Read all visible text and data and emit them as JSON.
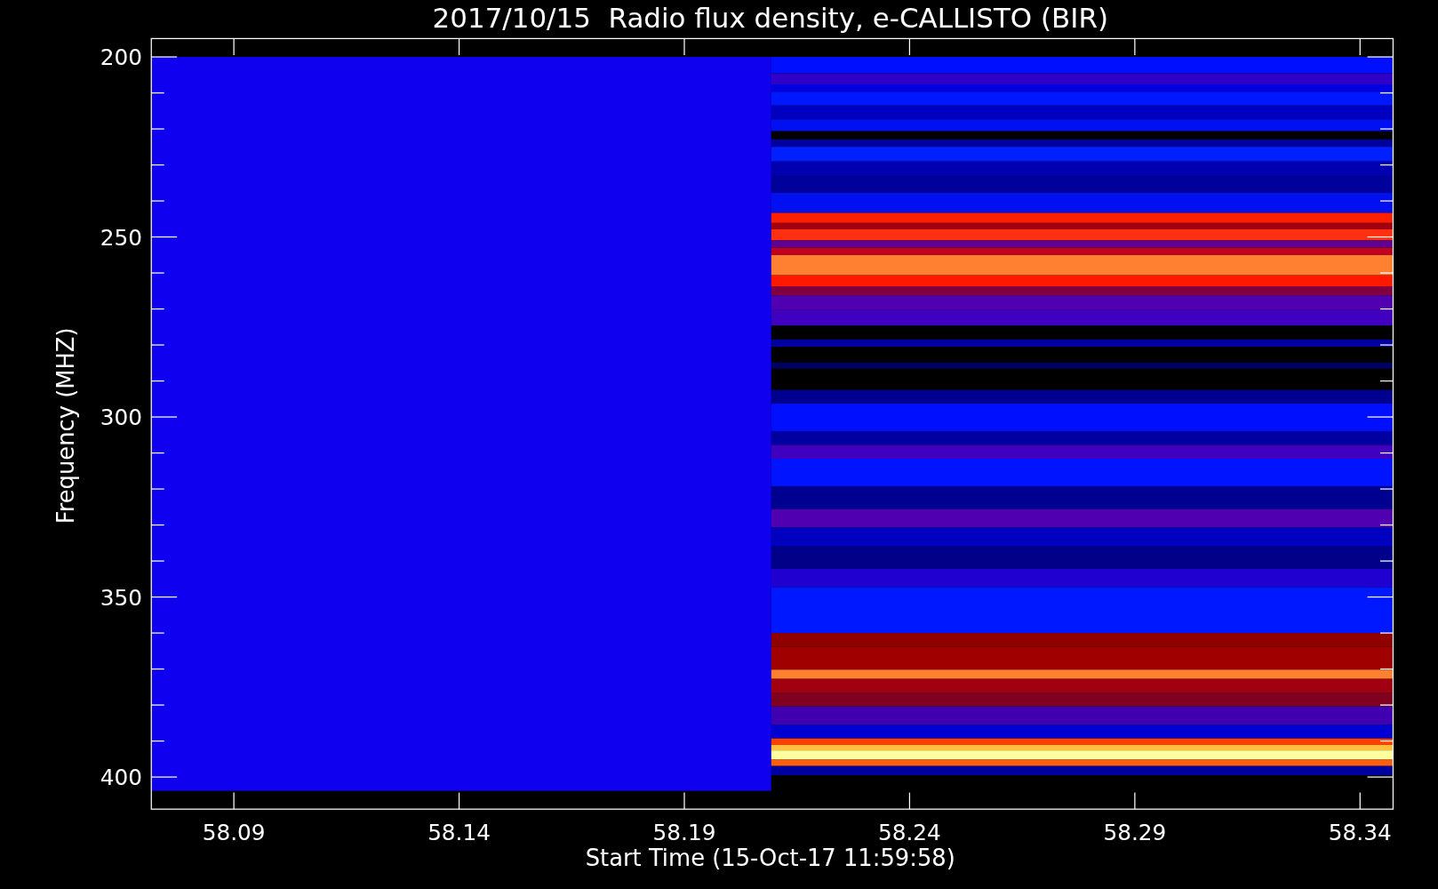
{
  "title": "2017/10/15  Radio flux density, e-CALLISTO (BIR)",
  "y_axis": {
    "label": "Frequency (MHZ)",
    "ticks": [
      "200",
      "250",
      "300",
      "350",
      "400"
    ]
  },
  "x_axis": {
    "label": "Start Time (15-Oct-17 11:59:58)",
    "ticks": [
      "58.09",
      "58.14",
      "58.19",
      "58.24",
      "58.29",
      "58.34"
    ]
  }
}
